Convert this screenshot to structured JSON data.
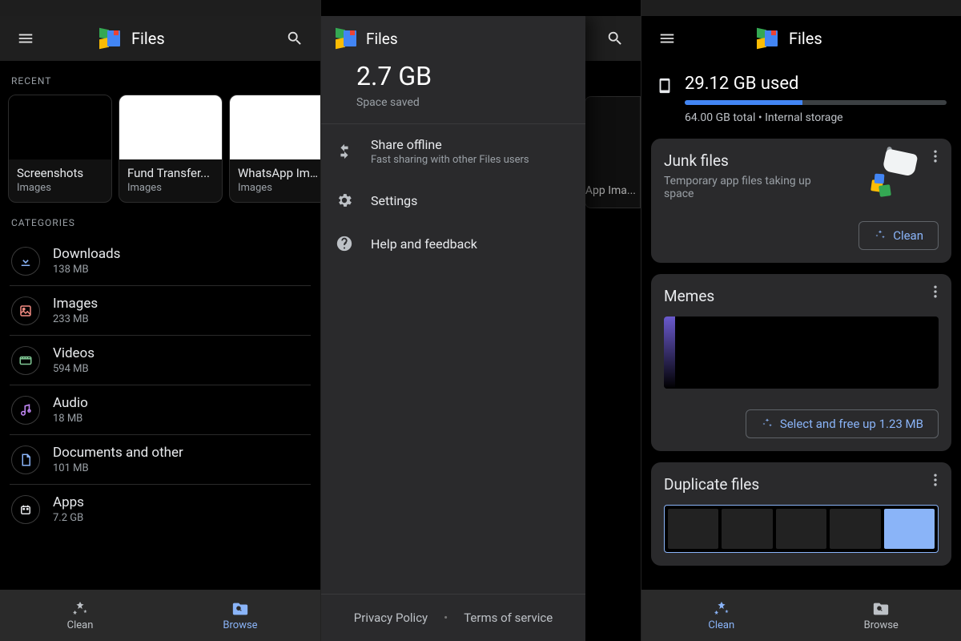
{
  "app": {
    "title": "Files"
  },
  "browse": {
    "recent_label": "RECENT",
    "recent": [
      {
        "name": "Screenshots",
        "sub": "Images",
        "thumb": "black"
      },
      {
        "name": "Fund Transfer...",
        "sub": "Images",
        "thumb": "white"
      },
      {
        "name": "WhatsApp Ima...",
        "sub": "Images",
        "thumb": "white"
      }
    ],
    "categories_label": "CATEGORIES",
    "categories": [
      {
        "name": "Downloads",
        "size": "138 MB",
        "icon": "download",
        "color": "#8ab4f8"
      },
      {
        "name": "Images",
        "size": "233 MB",
        "icon": "image",
        "color": "#f28b82"
      },
      {
        "name": "Videos",
        "size": "594 MB",
        "icon": "video",
        "color": "#81c995"
      },
      {
        "name": "Audio",
        "size": "18 MB",
        "icon": "audio",
        "color": "#c58af9"
      },
      {
        "name": "Documents and other",
        "size": "101 MB",
        "icon": "document",
        "color": "#8ab4f8"
      },
      {
        "name": "Apps",
        "size": "7.2 GB",
        "icon": "apps",
        "color": "#e8eaed"
      }
    ],
    "nav": {
      "clean": "Clean",
      "browse": "Browse"
    }
  },
  "drawer": {
    "space_saved_value": "2.7 GB",
    "space_saved_label": "Space saved",
    "items": [
      {
        "label": "Share offline",
        "sub": "Fast sharing with other Files users",
        "icon": "share"
      },
      {
        "label": "Settings",
        "icon": "settings"
      },
      {
        "label": "Help and feedback",
        "icon": "help"
      }
    ],
    "footer": {
      "privacy": "Privacy Policy",
      "terms": "Terms of service"
    },
    "bg_hint": "sApp Ima..."
  },
  "clean": {
    "used": "29.12 GB used",
    "total_line": "64.00 GB total • Internal storage",
    "fill_percent": 45,
    "cards": {
      "junk": {
        "title": "Junk files",
        "sub": "Temporary app files taking up space",
        "button": "Clean"
      },
      "memes": {
        "title": "Memes",
        "button": "Select and free up 1.23 MB"
      },
      "dup": {
        "title": "Duplicate files"
      }
    },
    "nav": {
      "clean": "Clean",
      "browse": "Browse"
    }
  }
}
